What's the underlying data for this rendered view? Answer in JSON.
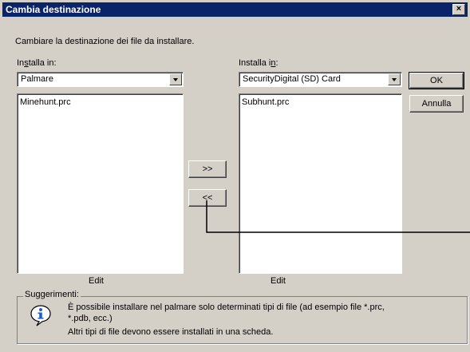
{
  "window": {
    "title": "Cambia destinazione",
    "close_symbol": "×"
  },
  "description": "Cambiare la destinazione dei file da installare.",
  "left": {
    "label_pre": "In",
    "label_u": "s",
    "label_post": "talla in:",
    "combo_value": "Palmare",
    "items": [
      "Minehunt.prc"
    ],
    "edit_label": "Edit"
  },
  "right": {
    "label_pre": "Installa i",
    "label_u": "n",
    "label_post": ":",
    "combo_value": "SecurityDigital (SD) Card",
    "items": [
      "Subhunt.prc"
    ],
    "edit_label": "Edit"
  },
  "move_right_label": ">>",
  "move_left_label": "<<",
  "ok_label": "OK",
  "cancel_label": "Annulla",
  "tips": {
    "legend": "Suggerimenti:",
    "line1": "È possibile installare nel palmare solo determinati tipi di file (ad esempio file *.prc,",
    "line2": "*.pdb, ecc.)",
    "line3": "Altri tipi di file devono essere installati in una scheda."
  },
  "colors": {
    "title_bar": "#0a246a",
    "face": "#d4d0c8",
    "info_icon": "#1c5bd0"
  }
}
